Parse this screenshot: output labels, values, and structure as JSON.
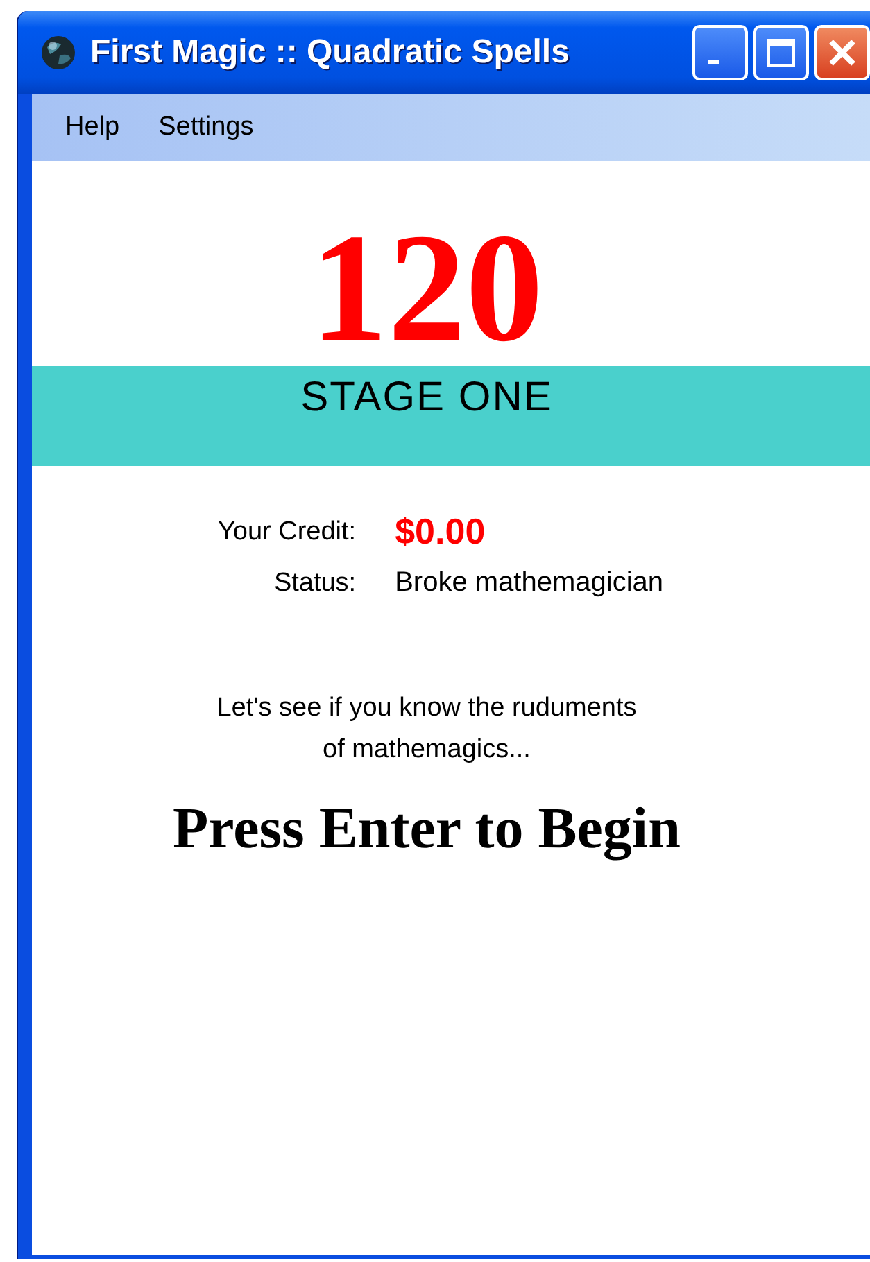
{
  "window": {
    "title": "First Magic :: Quadratic Spells"
  },
  "menu": [
    {
      "label": "Help"
    },
    {
      "label": "Settings"
    }
  ],
  "timer": "120",
  "stage": "STAGE ONE",
  "info": [
    {
      "label": "Your Credit:",
      "value": "$0.00",
      "kind": "money"
    },
    {
      "label": "Status:",
      "value": "Broke mathemagician",
      "kind": "plain"
    }
  ],
  "message": [
    "Let's see if you know the ruduments",
    "of mathemagics..."
  ],
  "prompt": "Press Enter to Begin"
}
